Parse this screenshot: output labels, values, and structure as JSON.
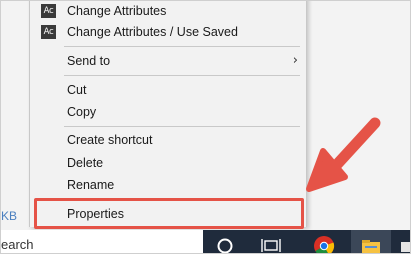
{
  "background_partial_text": "KB",
  "menu": {
    "items": [
      {
        "label": "Change Attributes",
        "icon": "Ac"
      },
      {
        "label": "Change Attributes / Use Saved",
        "icon": "Ac"
      },
      {
        "label": "Send to",
        "submenu_glyph": "›"
      },
      {
        "label": "Cut"
      },
      {
        "label": "Copy"
      },
      {
        "label": "Create shortcut"
      },
      {
        "label": "Delete"
      },
      {
        "label": "Rename"
      },
      {
        "label": "Properties"
      }
    ]
  },
  "taskbar": {
    "search_partial": "earch"
  },
  "colors": {
    "highlight": "#e55347",
    "arrow": "#e55347",
    "taskbar": "#1f2b3c"
  }
}
